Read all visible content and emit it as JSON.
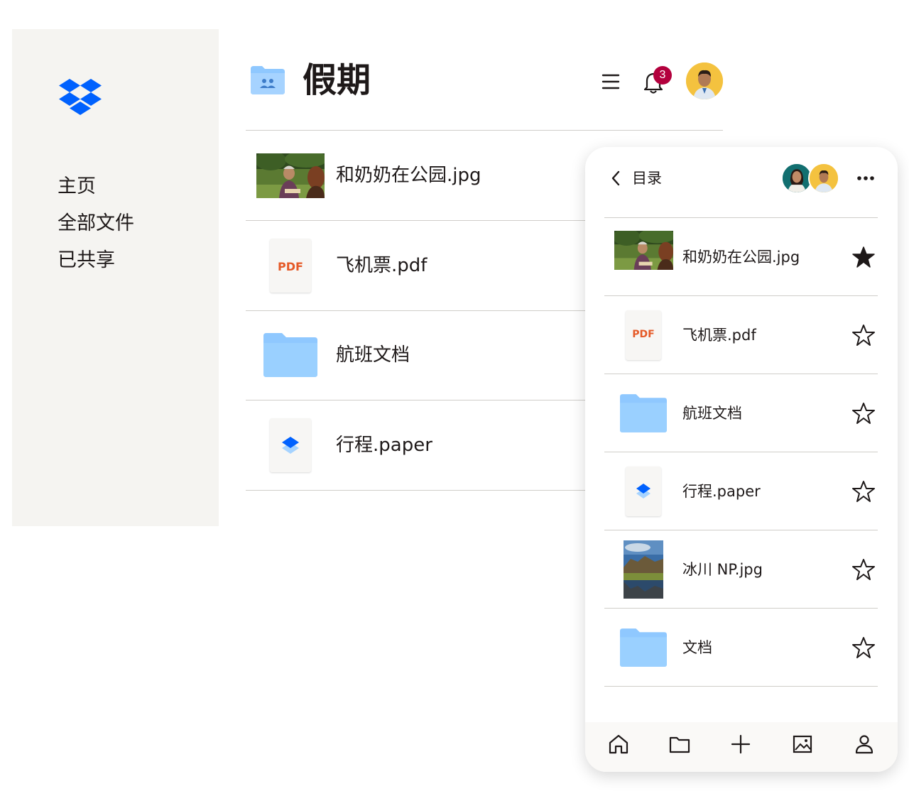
{
  "brand": {
    "logo_icon": "dropbox-logo",
    "accent": "#0061fe"
  },
  "sidebar": {
    "items": [
      {
        "label": "主页"
      },
      {
        "label": "全部文件"
      },
      {
        "label": "已共享"
      }
    ]
  },
  "header": {
    "title": "假期",
    "folder_icon": "shared-folder-icon",
    "menu_icon": "menu-icon",
    "bell_icon": "bell-icon",
    "notification_count": "3",
    "badge_color": "#b3003d",
    "avatar_icon": "user-avatar"
  },
  "files": [
    {
      "name": "和奶奶在公园.jpg",
      "kind": "image",
      "icon": "photo-thumbnail"
    },
    {
      "name": "飞机票.pdf",
      "kind": "pdf",
      "badge": "PDF",
      "icon": "pdf-file-icon"
    },
    {
      "name": "航班文档",
      "kind": "folder",
      "icon": "folder-icon"
    },
    {
      "name": "行程.paper",
      "kind": "paper",
      "icon": "paper-doc-icon"
    }
  ],
  "mobile": {
    "back_icon": "chevron-left-icon",
    "title": "目录",
    "more_icon": "more-horizontal-icon",
    "files": [
      {
        "name": "和奶奶在公园.jpg",
        "kind": "image",
        "starred": true
      },
      {
        "name": "飞机票.pdf",
        "kind": "pdf",
        "badge": "PDF",
        "starred": false
      },
      {
        "name": "航班文档",
        "kind": "folder",
        "starred": false
      },
      {
        "name": "行程.paper",
        "kind": "paper",
        "starred": false
      },
      {
        "name": "冰川 NP.jpg",
        "kind": "image",
        "starred": false
      },
      {
        "name": "文档",
        "kind": "folder",
        "starred": false
      }
    ],
    "tabs": [
      "home-icon",
      "folder-icon",
      "plus-icon",
      "photos-icon",
      "account-icon"
    ]
  }
}
